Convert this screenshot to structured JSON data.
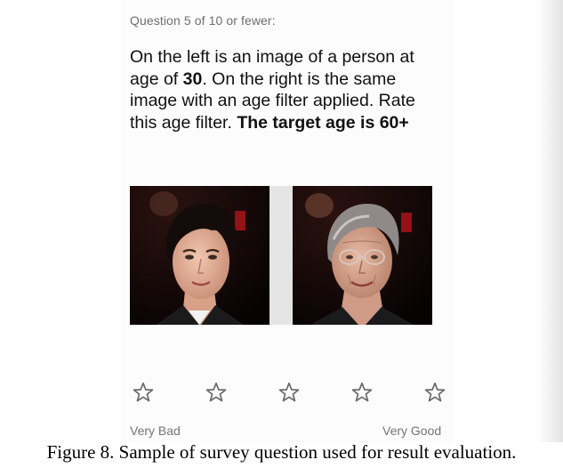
{
  "survey": {
    "progress": "Question 5 of 10 or fewer:",
    "question_part1": "On the left is an image of a person at age of ",
    "source_age": "30",
    "question_part2": ". On the right is the same image with an age filter applied. Rate this age filter. ",
    "target_text": "The target age is 60+",
    "rating": {
      "star_count": 5,
      "low_label": "Very Bad",
      "high_label": "Very Good",
      "selected": 0
    },
    "images": {
      "original_icon": "young-face-photo",
      "filtered_icon": "aged-face-photo"
    }
  },
  "caption": "Figure 8. Sample of survey question used for result evaluation.",
  "colors": {
    "star_outline": "#6b6b6b",
    "divider": "#e4e4e4",
    "photo_background": "#0b0404"
  }
}
